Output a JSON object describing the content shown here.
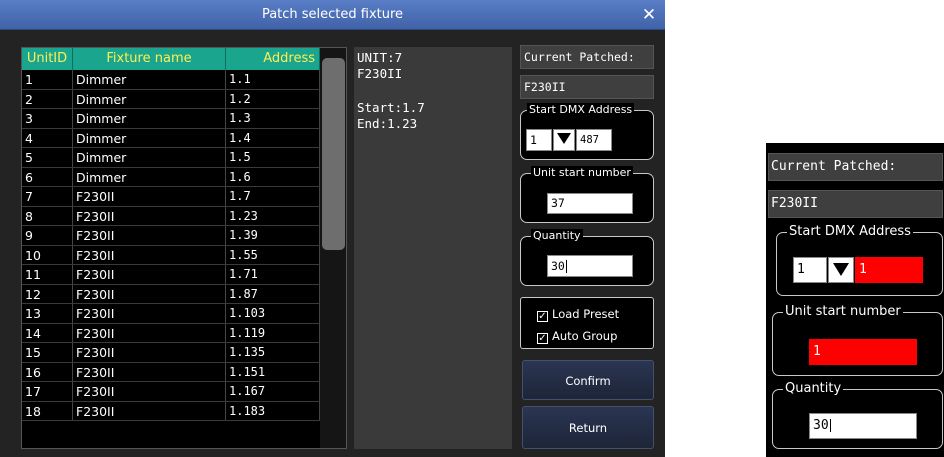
{
  "dialog": {
    "title": "Patch selected fixture",
    "close_glyph": "✕"
  },
  "table": {
    "headers": [
      "UnitID",
      "Fixture name",
      "Address"
    ],
    "rows": [
      [
        "1",
        "Dimmer",
        "1.1"
      ],
      [
        "2",
        "Dimmer",
        "1.2"
      ],
      [
        "3",
        "Dimmer",
        "1.3"
      ],
      [
        "4",
        "Dimmer",
        "1.4"
      ],
      [
        "5",
        "Dimmer",
        "1.5"
      ],
      [
        "6",
        "Dimmer",
        "1.6"
      ],
      [
        "7",
        "F230II",
        "1.7"
      ],
      [
        "8",
        "F230II",
        "1.23"
      ],
      [
        "9",
        "F230II",
        "1.39"
      ],
      [
        "10",
        "F230II",
        "1.55"
      ],
      [
        "11",
        "F230II",
        "1.71"
      ],
      [
        "12",
        "F230II",
        "1.87"
      ],
      [
        "13",
        "F230II",
        "1.103"
      ],
      [
        "14",
        "F230II",
        "1.119"
      ],
      [
        "15",
        "F230II",
        "1.135"
      ],
      [
        "16",
        "F230II",
        "1.151"
      ],
      [
        "17",
        "F230II",
        "1.167"
      ],
      [
        "18",
        "F230II",
        "1.183"
      ]
    ]
  },
  "info": {
    "unit": "UNIT:7",
    "fixture": "F230II",
    "start": "Start:1.7",
    "end": "End:1.23"
  },
  "right": {
    "current_patched_label": "Current Patched:",
    "current_patched_value": "F230II",
    "start_dmx_label": "Start DMX Address",
    "universe_value": "1",
    "address_value": "487",
    "unit_start_label": "Unit start number",
    "unit_start_value": "37",
    "quantity_label": "Quantity",
    "quantity_value": "30",
    "load_preset_label": "Load Preset",
    "auto_group_label": "Auto Group",
    "check_glyph": "✓",
    "confirm_label": "Confirm",
    "return_label": "Return"
  },
  "zoom": {
    "current_patched_label": "Current Patched:",
    "current_patched_value": "F230II",
    "start_dmx_label": "Start DMX Address",
    "universe_value": "1",
    "address_value": "1",
    "unit_start_label": "Unit start number",
    "unit_start_value": "1",
    "quantity_label": "Quantity",
    "quantity_value": "30"
  },
  "colors": {
    "title_bar": "#4a6fb8",
    "header_bg": "#1aa58e",
    "header_text": "#ffee55",
    "error_red": "#ff0000"
  }
}
